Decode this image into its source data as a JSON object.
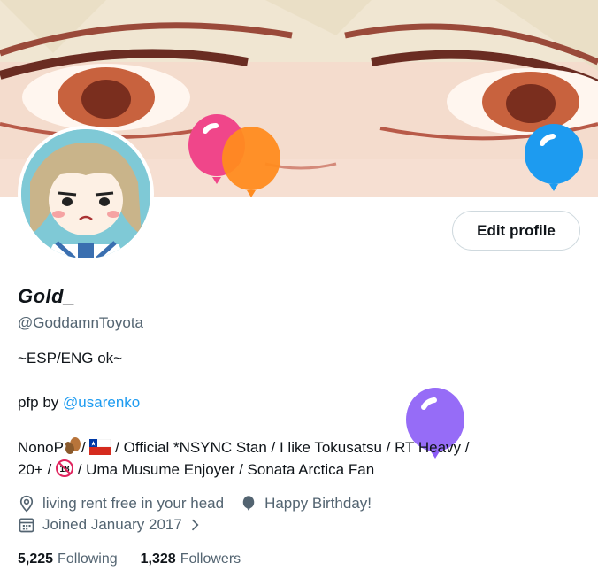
{
  "profile": {
    "display_name": "Gold_",
    "handle": "@GoddamnToyota",
    "edit_label": "Edit profile"
  },
  "bio": {
    "line1": "~ESP/ENG ok~",
    "pfp_prefix": "pfp by ",
    "pfp_link": "@usarenko",
    "line3_a": "NonoP",
    "line3_b": "/",
    "line3_c": " / Official *NSYNC Stan / I like Tokusatsu / RT Heavy /",
    "line4_a": "20+ / ",
    "line4_b": " / Uma Musume Enjoyer / Sonata Arctica Fan"
  },
  "meta": {
    "location": "living rent free in your head",
    "birthday": "Happy Birthday!",
    "joined": "Joined January 2017"
  },
  "stats": {
    "following_count": "5,225",
    "following_label": "Following",
    "followers_count": "1,328",
    "followers_label": "Followers"
  },
  "icons": {
    "location": "location-pin-icon",
    "birthday": "balloon-icon",
    "joined": "calendar-icon",
    "chevron": "chevron-right-icon"
  },
  "colors": {
    "link": "#1d9bf0",
    "muted": "#536471",
    "balloon_pink": "#f0468a",
    "balloon_orange": "#ff8b1f",
    "balloon_blue": "#1d9bf0",
    "balloon_purple": "#8b5cf6"
  }
}
